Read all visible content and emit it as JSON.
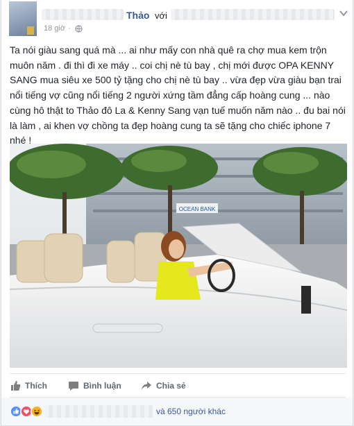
{
  "post": {
    "author": "Thảo",
    "with_label": "với",
    "timestamp": "18 giờ",
    "separator": "·",
    "text": "Ta nói giàu sang quá mà ... ai như mấy con nhà quê ra chợ mua kem trộn muôn năm . đi thì đi xe máy .. coi chị nè tù bay , chị mới được OPA KENNY SANG mua siêu xe 500 tỷ tặng cho chị nè tù bay .. vừa đẹp vừa giàu bạn trai nổi tiếng vợ cũng nổi tiếng 2 người xứng tầm đẳng cấp hoàng cung ... nào cùng hô thật to Thảo đô La & Kenny Sang vạn tuế muốn năm nào .. đu bai nói là làm , ai khen vợ chồng ta đẹp hoàng cung ta sẽ tặng cho chiếc iphone 7 nhé !"
  },
  "photo_sign": "OCEAN BANK",
  "actions": {
    "like": "Thích",
    "comment": "Bình luận",
    "share": "Chia sẻ"
  },
  "reactions": {
    "types": [
      "like-icon",
      "love-icon",
      "haha-icon"
    ],
    "colors": {
      "like": "#5890ff",
      "love": "#f25268",
      "haha": "#f7b125"
    },
    "others_text": "và 650 người khác"
  }
}
